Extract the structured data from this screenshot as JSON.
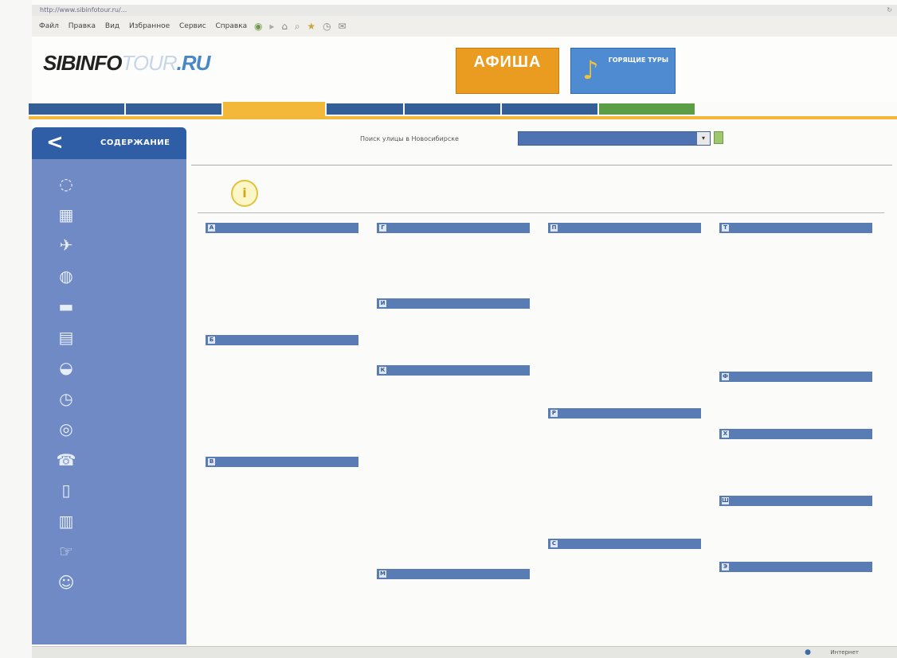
{
  "browser": {
    "url": "http://www.sibinfotour.ru/...",
    "menus": [
      "Файл",
      "Правка",
      "Вид",
      "Избранное",
      "Сервис",
      "Справка"
    ],
    "status_zone": "Интернет"
  },
  "header": {
    "logo_main": "SIBINFO",
    "logo_tour": "TOUR",
    "logo_ru": ".RU",
    "banner_afisha": "АФИША",
    "banner_afisha_sub": "",
    "banner_tours": "ГОРЯЩИЕ ТУРЫ"
  },
  "nav": {
    "tabs": [
      {
        "label": "",
        "width": 120
      },
      {
        "label": "",
        "width": 120
      },
      {
        "label": "",
        "width": 128,
        "active": true
      },
      {
        "label": "",
        "width": 96
      },
      {
        "label": "",
        "width": 120
      },
      {
        "label": "",
        "width": 120
      },
      {
        "label": "",
        "width": 120,
        "green": true
      }
    ]
  },
  "sidebar": {
    "title": "СОДЕРЖАНИЕ",
    "items": [
      {
        "icon": "circle-icon",
        "glyph": "◌",
        "label": ""
      },
      {
        "icon": "map-icon",
        "glyph": "▦",
        "label": ""
      },
      {
        "icon": "plane-icon",
        "glyph": "✈",
        "label": ""
      },
      {
        "icon": "globe-icon",
        "glyph": "◍",
        "label": ""
      },
      {
        "icon": "car-icon",
        "glyph": "▬",
        "label": ""
      },
      {
        "icon": "document-icon",
        "glyph": "▤",
        "label": ""
      },
      {
        "icon": "ship-icon",
        "glyph": "◒",
        "label": ""
      },
      {
        "icon": "clock-icon",
        "glyph": "◷",
        "label": ""
      },
      {
        "icon": "bike-icon",
        "glyph": "◎",
        "label": ""
      },
      {
        "icon": "phone-icon",
        "glyph": "☎",
        "label": ""
      },
      {
        "icon": "bag-icon",
        "glyph": "▯",
        "label": ""
      },
      {
        "icon": "building-icon",
        "glyph": "▥",
        "label": ""
      },
      {
        "icon": "hand-icon",
        "glyph": "☞",
        "label": ""
      },
      {
        "icon": "user-icon",
        "glyph": "☺",
        "label": ""
      }
    ]
  },
  "search": {
    "label": "Поиск улицы в Новосибирске",
    "selected": ""
  },
  "section": {
    "title": "",
    "info_icon": "i"
  },
  "columns": [
    [
      {
        "letter": "А",
        "items": [
          "",
          "",
          "",
          "",
          "",
          "",
          "",
          ""
        ]
      },
      {
        "letter": "Б",
        "items": [
          "",
          "",
          "",
          "",
          "",
          "",
          "",
          "",
          ""
        ]
      },
      {
        "letter": "В",
        "items": [
          "",
          "",
          "",
          "",
          "",
          "",
          "",
          "",
          ""
        ]
      }
    ],
    [
      {
        "letter": "Г",
        "items": [
          "",
          "",
          "",
          ""
        ]
      },
      {
        "letter": "И",
        "items": [
          "",
          "",
          ""
        ]
      },
      {
        "letter": "К",
        "items": [
          "",
          "",
          "",
          "",
          "",
          "",
          "",
          "",
          "",
          "",
          "",
          "",
          "",
          "",
          "",
          "",
          "",
          ""
        ]
      },
      {
        "letter": "М",
        "items": [
          ""
        ]
      }
    ],
    [
      {
        "letter": "П",
        "items": [
          "",
          "",
          "",
          "",
          "",
          "",
          "",
          "",
          "",
          "",
          "",
          "",
          "",
          "",
          "",
          ""
        ]
      },
      {
        "letter": "Р",
        "items": [
          "",
          "",
          "",
          "",
          "",
          "",
          "",
          "",
          "",
          ""
        ]
      },
      {
        "letter": "С",
        "items": [
          "",
          "",
          "",
          ""
        ]
      }
    ],
    [
      {
        "letter": "Т",
        "items": [
          "",
          "",
          "",
          "",
          "",
          "",
          "",
          "",
          "",
          "",
          "",
          ""
        ]
      },
      {
        "letter": "Ф",
        "items": [
          "",
          ""
        ]
      },
      {
        "letter": "Х",
        "items": [
          "",
          "",
          ""
        ]
      },
      {
        "letter": "Ш",
        "items": [
          "",
          "",
          ""
        ]
      },
      {
        "letter": "Э",
        "items": []
      }
    ]
  ]
}
